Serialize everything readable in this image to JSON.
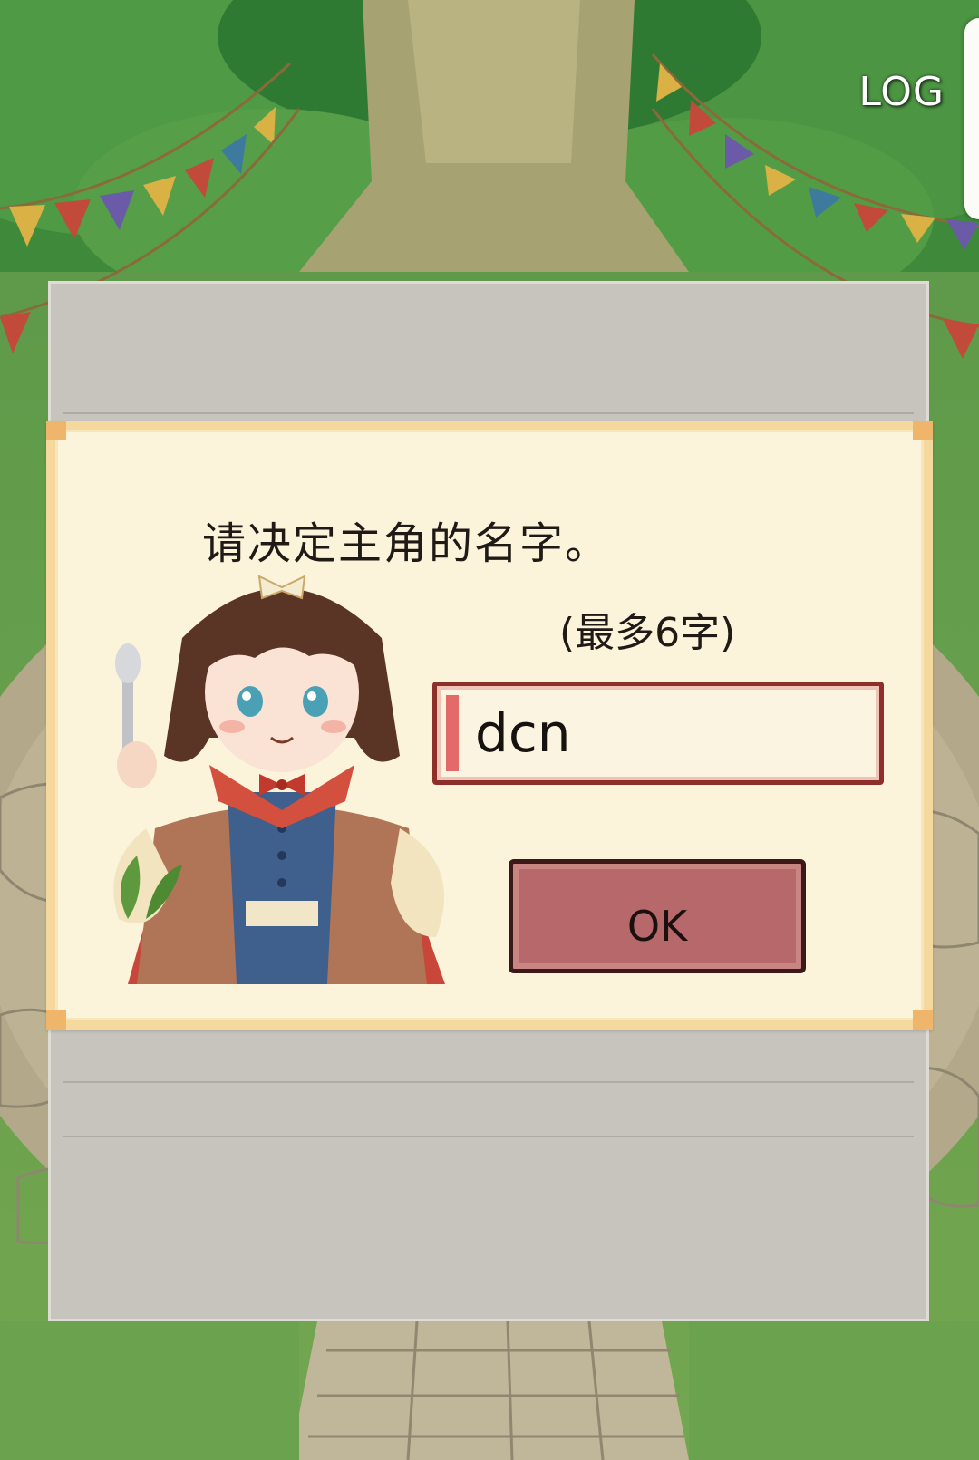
{
  "header": {
    "log_label": "LOG"
  },
  "dialog": {
    "prompt": "请决定主角的名字。",
    "limit_hint": "(最多6字)",
    "name_input": {
      "value": "dcn",
      "placeholder": ""
    },
    "ok_label": "OK"
  },
  "colors": {
    "panel_cream": "#fbf3da",
    "panel_border": "#f4d89e",
    "panel_gray": "#c6c4bd",
    "ok_button": "#b6686a",
    "field_border": "#8d3029",
    "field_accent": "#e46a6a"
  }
}
